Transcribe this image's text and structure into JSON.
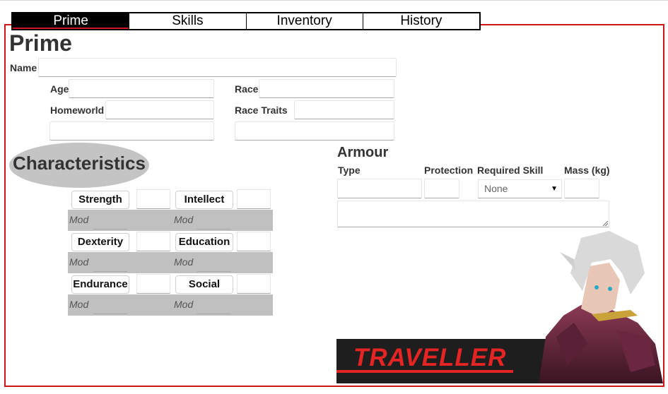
{
  "tabs": [
    {
      "label": "Prime",
      "active": true
    },
    {
      "label": "Skills",
      "active": false
    },
    {
      "label": "Inventory",
      "active": false
    },
    {
      "label": "History",
      "active": false
    }
  ],
  "page": {
    "title": "Prime"
  },
  "prime": {
    "name_label": "Name",
    "age_label": "Age",
    "race_label": "Race",
    "homeworld_label": "Homeworld",
    "race_traits_label": "Race Traits"
  },
  "characteristics": {
    "title": "Characteristics",
    "mod_label": "Mod",
    "items": [
      {
        "label": "Strength"
      },
      {
        "label": "Intellect"
      },
      {
        "label": "Dexterity"
      },
      {
        "label": "Education"
      },
      {
        "label": "Endurance"
      },
      {
        "label": "Social"
      }
    ]
  },
  "armour": {
    "title": "Armour",
    "columns": [
      "Type",
      "Protection",
      "Required Skill",
      "Mass (kg)"
    ],
    "required_skill_selected": "None"
  },
  "logo": {
    "text": "TRAVELLER"
  },
  "colors": {
    "accent": "#d21414",
    "band": "#c0c0c0",
    "logo_bg": "#1e1e1e",
    "logo_text": "#e52424"
  }
}
